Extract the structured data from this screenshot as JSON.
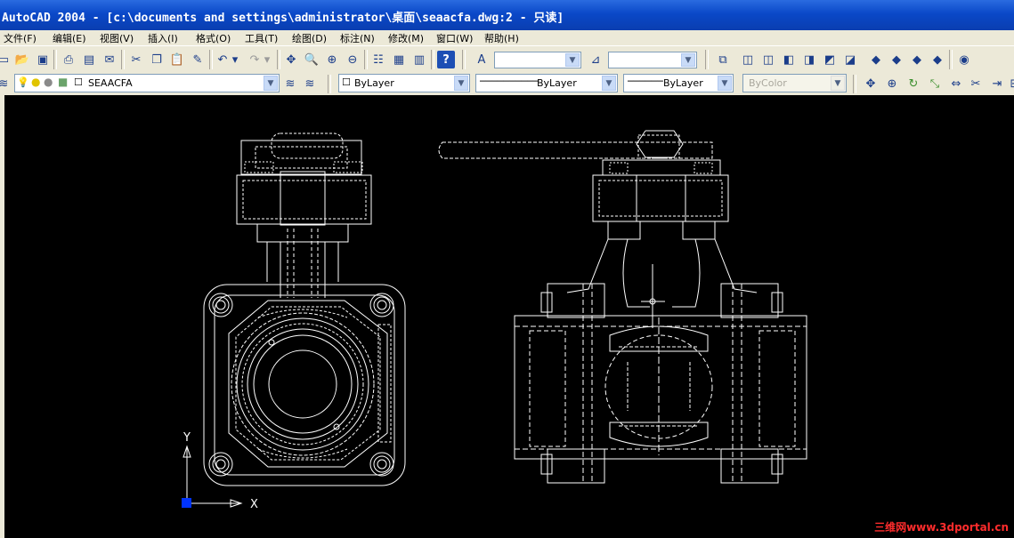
{
  "window": {
    "title": "AutoCAD 2004 - [c:\\documents and settings\\administrator\\桌面\\seaacfa.dwg:2 - 只读]"
  },
  "menu": [
    {
      "label": "文件(F)"
    },
    {
      "label": "编辑(E)"
    },
    {
      "label": "视图(V)"
    },
    {
      "label": "插入(I)"
    },
    {
      "label": "格式(O)"
    },
    {
      "label": "工具(T)"
    },
    {
      "label": "绘图(D)"
    },
    {
      "label": "标注(N)"
    },
    {
      "label": "修改(M)"
    },
    {
      "label": "窗口(W)"
    },
    {
      "label": "帮助(H)"
    }
  ],
  "layers": {
    "current_layer": "SEAACFA",
    "color": "ByLayer",
    "linetype": "ByLayer",
    "lineweight": "ByLayer",
    "plotstyle": "ByColor"
  },
  "viewport": {
    "axis_x": "X",
    "axis_y": "Y",
    "background": "#000000",
    "line_color": "#FFFFFF",
    "ucs_color": "#0033FF"
  },
  "watermark": "三维网www.3dportal.cn",
  "colors": {
    "title_bar": "#0A48C8",
    "chrome": "#ECE9D8",
    "watermark": "#FF2C2C"
  }
}
